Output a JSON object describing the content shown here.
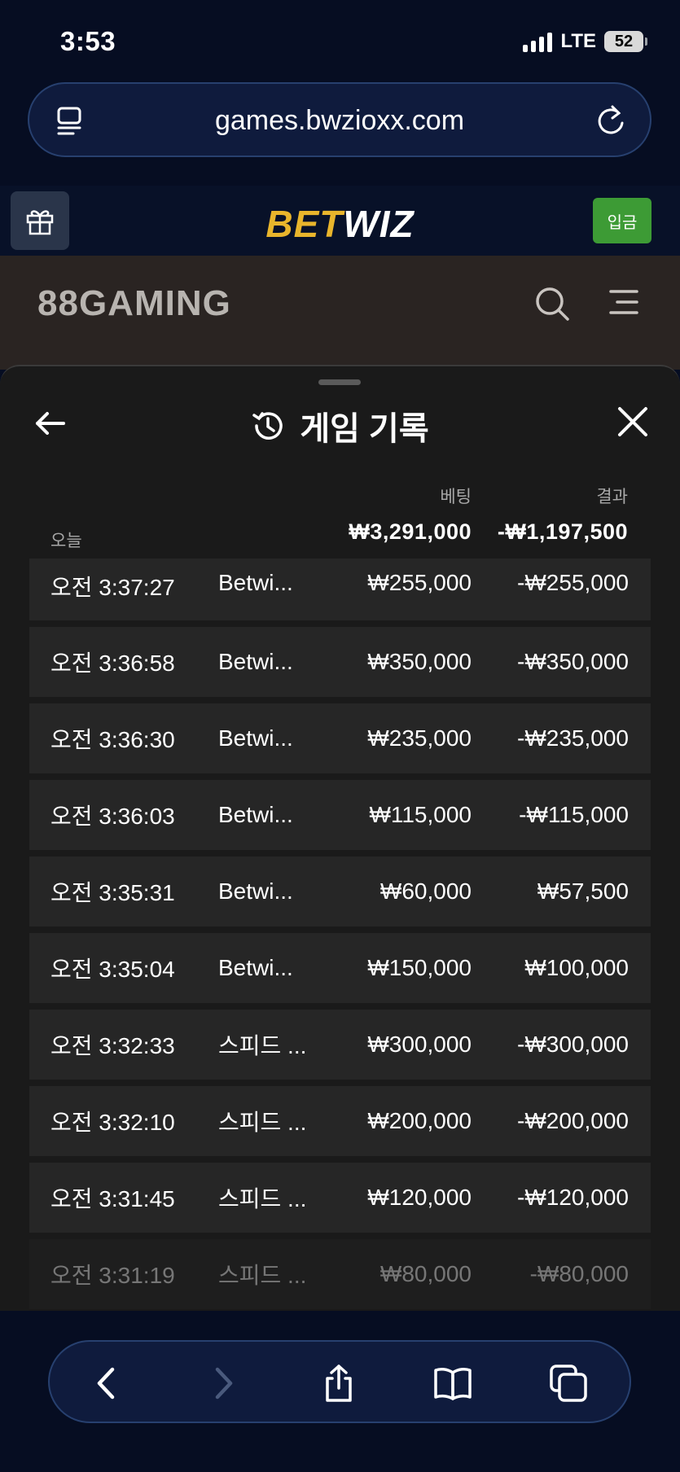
{
  "status": {
    "time": "3:53",
    "network": "LTE",
    "battery": "52"
  },
  "browser": {
    "url": "games.bwzioxx.com"
  },
  "site": {
    "logo_bet": "BET",
    "logo_wiz": "WIZ",
    "deposit_label": "입금",
    "provider_logo": "88GAMING"
  },
  "history": {
    "title": "게임 기록",
    "col_bet": "베팅",
    "col_result": "결과",
    "day_label": "오늘",
    "total_bet": "₩3,291,000",
    "total_result": "-₩1,197,500",
    "rows": [
      {
        "time": "오전 3:37:27",
        "game": "Betwi...",
        "bet": "₩255,000",
        "result": "-₩255,000"
      },
      {
        "time": "오전 3:36:58",
        "game": "Betwi...",
        "bet": "₩350,000",
        "result": "-₩350,000"
      },
      {
        "time": "오전 3:36:30",
        "game": "Betwi...",
        "bet": "₩235,000",
        "result": "-₩235,000"
      },
      {
        "time": "오전 3:36:03",
        "game": "Betwi...",
        "bet": "₩115,000",
        "result": "-₩115,000"
      },
      {
        "time": "오전 3:35:31",
        "game": "Betwi...",
        "bet": "₩60,000",
        "result": "₩57,500"
      },
      {
        "time": "오전 3:35:04",
        "game": "Betwi...",
        "bet": "₩150,000",
        "result": "₩100,000"
      },
      {
        "time": "오전 3:32:33",
        "game": "스피드 ...",
        "bet": "₩300,000",
        "result": "-₩300,000"
      },
      {
        "time": "오전 3:32:10",
        "game": "스피드 ...",
        "bet": "₩200,000",
        "result": "-₩200,000"
      },
      {
        "time": "오전 3:31:45",
        "game": "스피드 ...",
        "bet": "₩120,000",
        "result": "-₩120,000"
      },
      {
        "time": "오전 3:31:19",
        "game": "스피드 ...",
        "bet": "₩80,000",
        "result": "-₩80,000"
      }
    ]
  },
  "icons": {
    "reader": "reader-icon",
    "reload": "reload-icon",
    "gift": "gift-icon",
    "search": "search-icon",
    "menu": "menu-icon",
    "back": "back-arrow-icon",
    "history": "history-icon",
    "close": "close-icon",
    "toolbar": [
      "chevron-left-icon",
      "chevron-right-icon",
      "share-icon",
      "bookmarks-icon",
      "tabs-icon"
    ]
  }
}
